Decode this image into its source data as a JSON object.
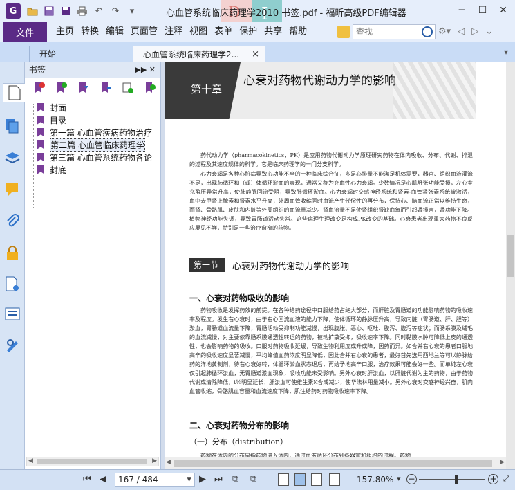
{
  "window": {
    "title": "心血管系统临床药理学2010 书签.pdf - 福昕高级PDF编辑器",
    "watermark_letters": [
      "D",
      "I"
    ]
  },
  "quick_access": {
    "icons": [
      "open-folder-icon",
      "save-icon",
      "save-as-icon",
      "print-icon",
      "undo-icon",
      "redo-icon",
      "customize-dropdown-icon"
    ]
  },
  "menubar": {
    "file_label": "文件",
    "items": [
      "主页",
      "转换",
      "编辑",
      "页面管",
      "注释",
      "视图",
      "表单",
      "保护",
      "共享",
      "帮助"
    ],
    "search_placeholder": "查找"
  },
  "tabs": {
    "start_label": "开始",
    "doc_label": "心血管系统临床药理学2...",
    "close_symbol": "×"
  },
  "bookmarks": {
    "header": "书签",
    "tools": [
      "delete-bookmark-icon",
      "add-bookmark-icon",
      "bookmark-forward-icon",
      "bookmark-add-child-icon",
      "bookmark-expand-icon",
      "bookmark-check-icon"
    ],
    "items": [
      {
        "label": "封面",
        "selected": false
      },
      {
        "label": "目录",
        "selected": false
      },
      {
        "label": "第一篇  心血管疾病药物治疗",
        "selected": false
      },
      {
        "label": "第二篇  心血管临床药理学",
        "selected": true
      },
      {
        "label": "第三篇  心血管系统药物各论",
        "selected": false
      },
      {
        "label": "封底",
        "selected": false
      }
    ]
  },
  "rail": {
    "icons": [
      "page-thumbnail-icon",
      "pages-icon",
      "layers-icon",
      "comments-icon",
      "attachments-icon",
      "security-icon",
      "document-properties-icon",
      "form-fields-icon",
      "signature-icon"
    ]
  },
  "document": {
    "chapter_label": "第十章",
    "chapter_title": "心衰对药物代谢动力学的影响",
    "intro_paragraph_1": "药代动力学（pharmacokinetics，PK）是应用药物代谢动力学原理研究药物在体内吸收、分布、代谢、排泄的过程及其速度规律的科学。它是临床药理学的一门分支科学。",
    "intro_paragraph_2": "心力衰竭是各种心脏病导致心功能不全的一种临床综合征，多是心排量不能满足机体需要，器官、组织血液灌流不足，出现肺循环和（或）体循环淤血的表现，通常又称为充血性心力衰竭。少数情况是心肌舒张功能受损，左心室充盈压异常升高，使肺静脉回流受阻，导致肺循环淤血。心力衰竭时交感神经系统和肾素-血管紧张素系统被激活，血中去甲肾上腺素和肾素水平升高，外周血管收缩同时血流产生代偿性的再分布，保持心、脑血流正常以维持生命，而肾、骨骼肌、皮肤和内脏等外周组织的血流量减少。肾血流量不足使肾组织肾缺血氧而引起肾损害，肾功能下降。植物神经功能失调，导致胃肠道活动失常。这些病理生理改变是构成PK改变的基础。心衰患者出现重大药物不良反应屡见不鲜，特别是一些治疗窗窄的药物。",
    "section_tag": "第一节",
    "section_title": "心衰对药物代谢动力学的影响",
    "h2_1": "一、心衰对药物吸收的影响",
    "absorption_paragraph": "药物吸收是发挥药效的前提。在各种给药途径中口服给药占绝大部分，而肝脏及胃肠道的功能影响药物的吸收速率及程度。发生右心衰时，由于右心回流血液的能力下降，使体循环的静脉压升高，导致内脏（胃肠道、肝、胆等）淤血，胃肠道血流量下降，胃肠活动受抑制功能减慢，出现腹胀、恶心、呕吐、腹泻、腹泻等症状；而肠系膜及绒毛的血流减慢，对主要依靠肠系膜通透性转运的药物，被动扩散受抑，吸收速率下降。同时黏膜水肿可降低上皮的通透性，也会影响药物的吸收。口服时药物吸收延缓，导致生物利用度或升或降，因药而异。如合并右心衰的患者口服地高辛的吸收速度显著减慢，平均峰值血药浓度明显降低，因此合并右心衰的患者，最好首先选用西地兰等可以静脉给药的洋地黄制剂，待右心衰好转，体循环淤血状态退后，再给予地高辛口服，治疗效果可能会好一些。而单纯左心衰仅引起肺循环淤血，无胃肠道淤血现象，吸收功能未受影响。另外心衰时肝淤血，以肝脏代谢为主的药物，由于药物代谢或清除降低，t½明显延长；肝淤血可使维生素K合成减少，使华法林用量减小。另外心衰时交感神经兴奋，肌肉血管收缩，骨骼肌血容量和血流速度下降，肌注给药时药物吸收速率下降。",
    "h2_2": "二、心衰对药物分布的影响",
    "h3_1": "（一）分布（distribution）",
    "tail_line": "药物在体内的分布是指药物进入体内，通过血液循环分布到各器官和组织的过程。药物"
  },
  "statusbar": {
    "page_display": "167 / 484",
    "zoom": "157.80%"
  },
  "colors": {
    "accent_purple": "#5a2a86",
    "titlebar_bg": "#e6eefb",
    "bookmark_flag": "#7a3e9a"
  }
}
